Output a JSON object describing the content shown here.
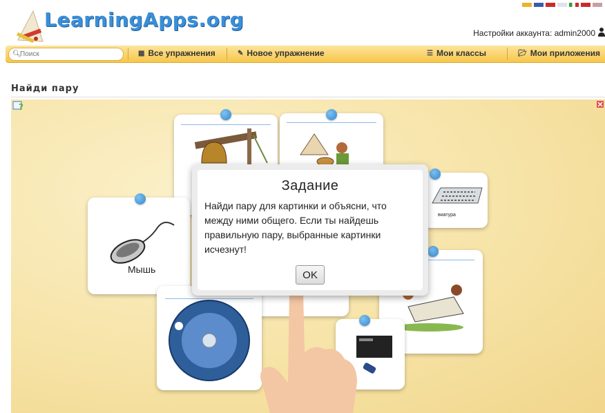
{
  "header": {
    "logo_text": "LearningApps.org",
    "account_label": "Настройки аккаунта: admin2000"
  },
  "flags": [
    "#e8b52a",
    "#3b5bb0",
    "#cc2a2a",
    "#dde3ea",
    "#3a9a3a",
    "#cc2a2a",
    "#cc2a2a"
  ],
  "nav": {
    "search_placeholder": "Поиск",
    "all_exercises": "Все упражнения",
    "new_exercise": "Новое упражнение",
    "my_classes": "Мои классы",
    "my_apps": "Мои приложения"
  },
  "page": {
    "title": "Найди пару"
  },
  "cards": {
    "mouse_label": "Мышь",
    "keyboard_label": "виатура"
  },
  "dialog": {
    "title": "Задание",
    "body": "Найди пару для картинки и объясни, что между ними общего. Если ты найдешь правильную пару, выбранные картинки исчезнут!",
    "ok_label": "OK"
  },
  "colors": {
    "logo_blue": "#3a8fd8",
    "nav_bar": "#f7c64b",
    "pin_blue": "#3587cf",
    "game_bg": "#f6e2a4"
  }
}
